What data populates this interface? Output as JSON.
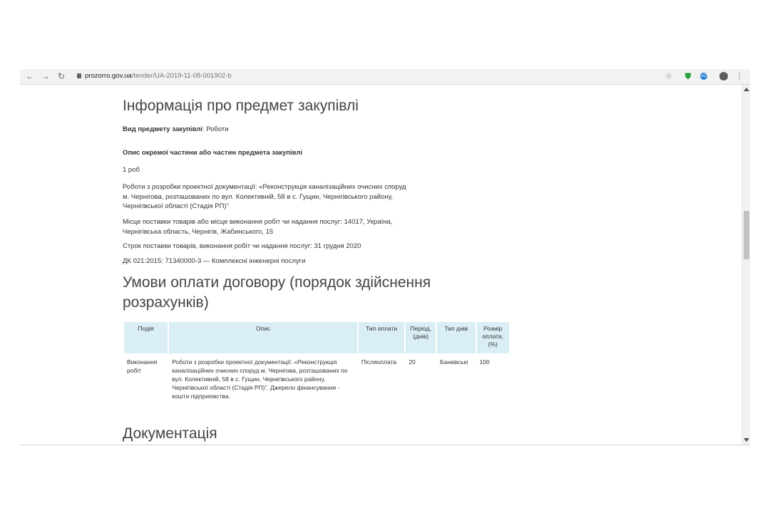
{
  "browser": {
    "url_domain": "prozorro.gov.ua",
    "url_path": "/tender/UA-2019-11-08-001902-b"
  },
  "section1": {
    "title": "Інформація про предмет закупівлі",
    "item_type_label": "Вид предмету закупівлі",
    "item_type_value": ": Роботи",
    "lot_desc_heading": "Опис окремої частини або частин предмета закупівлі",
    "quantity": "1 роб",
    "description": "Роботи з розробки проектної документації: «Реконструкція каналізаційних очисних споруд м. Чернігова, розташованих по вул. Колективній, 58 в с. Гущин, Чернігівського району, Чернігівської області (Стадія РП)”",
    "delivery_place": "Місце поставки товарів або місце виконання робіт чи надання послуг: 14017, Україна, Чернігівська область, Чернігів, Жабинського, 15",
    "delivery_date": "Строк поставки товарів, виконання робіт чи надання послуг: 31 грудня 2020",
    "classifier": "ДК 021:2015: 71340000-3 — Комплексні інженерні послуги"
  },
  "section2": {
    "title": "Умови оплати договору (порядок здійснення розрахунків)",
    "table": {
      "headers": [
        "Подія",
        "Опис",
        "Тип оплати",
        "Період, (днів)",
        "Тип днів",
        "Розмір оплати, (%)"
      ],
      "rows": [
        [
          "Виконання робіт",
          "Роботи з розробки проектної документації: «Реконструкція каналізаційних очисних споруд м. Чернігова, розташованих по вул. Колективній, 58 в с. Гущин, Чернігівського району, Чернігівської області (Стадія РП)”. Джерело фінансування - кошти підприємства.",
          "Післяоплата",
          "20",
          "Банківські",
          "100"
        ]
      ]
    }
  },
  "section3": {
    "title": "Документація"
  }
}
